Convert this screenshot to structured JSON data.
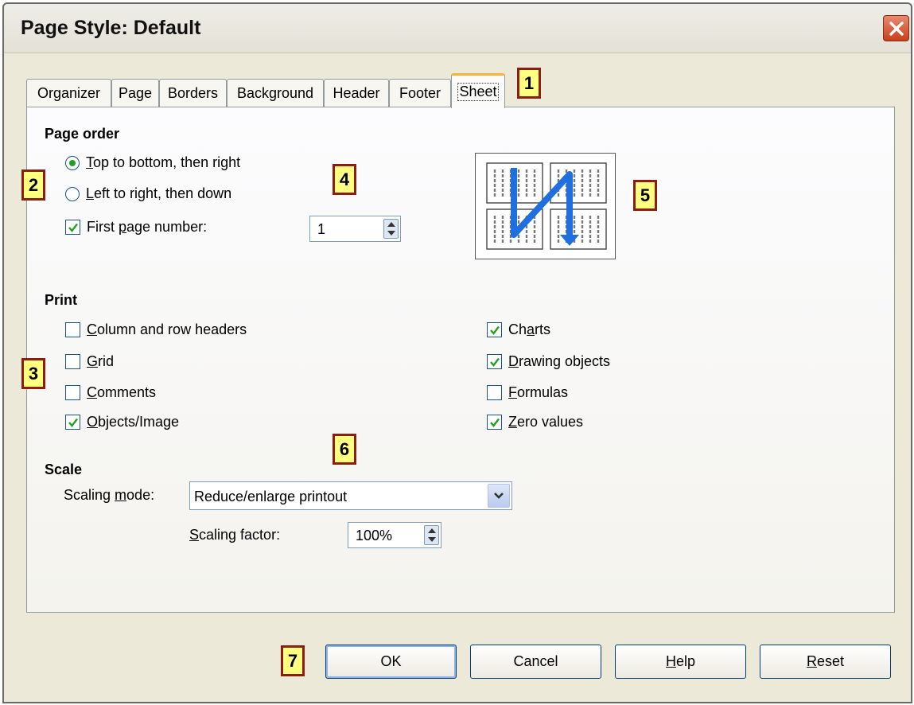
{
  "window": {
    "title": "Page Style: Default"
  },
  "tabs": [
    {
      "label": "Organizer"
    },
    {
      "label": "Page"
    },
    {
      "label": "Borders"
    },
    {
      "label": "Background"
    },
    {
      "label": "Header"
    },
    {
      "label": "Footer"
    },
    {
      "label": "Sheet",
      "active": true
    }
  ],
  "page_order": {
    "heading": "Page order",
    "radio_top_bottom": {
      "pre": "",
      "u": "T",
      "post": "op to bottom, then right",
      "selected": true
    },
    "radio_left_right": {
      "pre": "",
      "u": "L",
      "post": "eft to right, then down",
      "selected": false
    },
    "first_page_number": {
      "pre": "First ",
      "u": "p",
      "post": "age number:",
      "checked": true,
      "value": "1"
    }
  },
  "print": {
    "heading": "Print",
    "column_row_headers": {
      "pre": "",
      "u": "C",
      "post": "olumn and row headers",
      "checked": false
    },
    "grid": {
      "pre": "",
      "u": "G",
      "post": "rid",
      "checked": false
    },
    "comments": {
      "pre": "",
      "u": "C",
      "post": "omments",
      "checked": false
    },
    "objects_image": {
      "pre": "",
      "u": "O",
      "post": "bjects/Image",
      "checked": true
    },
    "charts": {
      "pre": "Ch",
      "u": "a",
      "post": "rts",
      "checked": true
    },
    "drawing_objects": {
      "pre": "",
      "u": "D",
      "post": "rawing objects",
      "checked": true
    },
    "formulas": {
      "pre": "",
      "u": "F",
      "post": "ormulas",
      "checked": false
    },
    "zero_values": {
      "pre": "",
      "u": "Z",
      "post": "ero values",
      "checked": true
    }
  },
  "scale": {
    "heading": "Scale",
    "mode_label": {
      "pre": "Scaling ",
      "u": "m",
      "post": "ode:"
    },
    "mode_value": "Reduce/enlarge printout",
    "factor_label": {
      "pre": "",
      "u": "S",
      "post": "caling factor:"
    },
    "factor_value": "100%"
  },
  "buttons": {
    "ok": "OK",
    "cancel": "Cancel",
    "help": {
      "pre": "",
      "u": "H",
      "post": "elp"
    },
    "reset": {
      "pre": "",
      "u": "R",
      "post": "eset"
    }
  },
  "callouts": [
    "1",
    "2",
    "3",
    "4",
    "5",
    "6",
    "7"
  ],
  "colors": {
    "check_green": "#21a121",
    "callout_fill": "#ffff80",
    "callout_border": "#8b1e10",
    "active_tab_accent": "#f6b53c",
    "order_arrow": "#1f6fe0"
  },
  "icons": {
    "close": "close-x-icon",
    "check": "checkmark-icon",
    "spin": "spin-up-down-icon",
    "dropdown": "chevron-down-icon",
    "page_order_preview": "page-order-preview-icon"
  }
}
